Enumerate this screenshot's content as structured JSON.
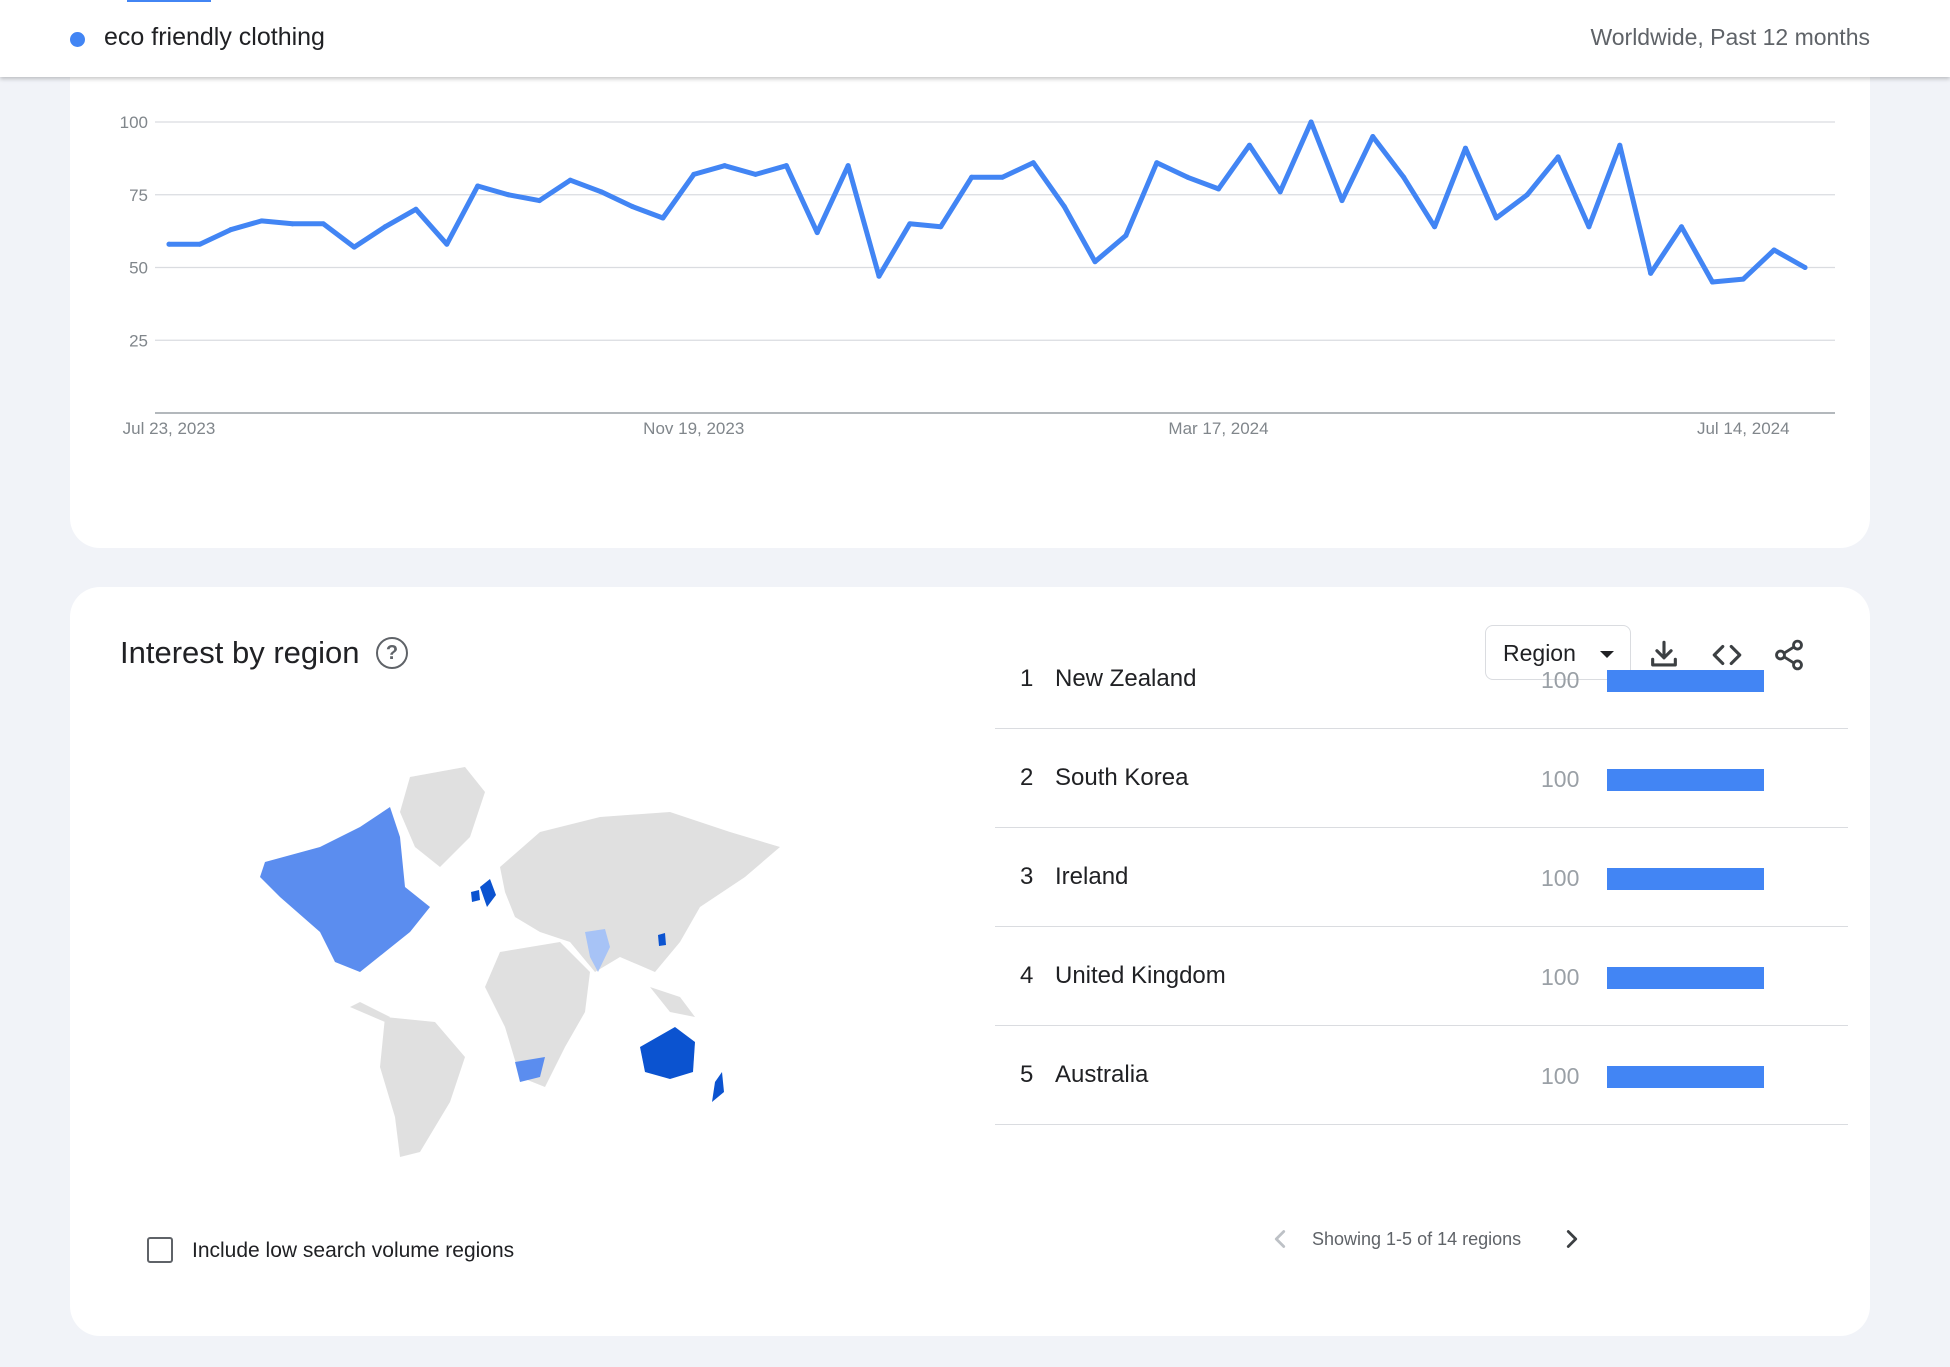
{
  "header": {
    "term": "eco friendly clothing",
    "term_color": "#4285f4",
    "scope": "Worldwide, Past 12 months"
  },
  "chart_data": {
    "type": "line",
    "title": "",
    "xlabel": "",
    "ylabel": "",
    "ylim": [
      0,
      100
    ],
    "yticks": [
      "100",
      "75",
      "50",
      "25"
    ],
    "xticks": [
      "Jul 23, 2023",
      "Nov 19, 2023",
      "Mar 17, 2024",
      "Jul 14, 2024"
    ],
    "grid": true,
    "series": [
      {
        "color": "#4285f4",
        "x": [
          "2023-07-23",
          "2023-07-30",
          "2023-08-06",
          "2023-08-13",
          "2023-08-20",
          "2023-08-27",
          "2023-09-03",
          "2023-09-10",
          "2023-09-17",
          "2023-09-24",
          "2023-10-01",
          "2023-10-08",
          "2023-10-15",
          "2023-10-22",
          "2023-10-29",
          "2023-11-05",
          "2023-11-12",
          "2023-11-19",
          "2023-11-26",
          "2023-12-03",
          "2023-12-10",
          "2023-12-17",
          "2023-12-24",
          "2023-12-31",
          "2024-01-07",
          "2024-01-14",
          "2024-01-21",
          "2024-01-28",
          "2024-02-04",
          "2024-02-11",
          "2024-02-18",
          "2024-02-25",
          "2024-03-03",
          "2024-03-10",
          "2024-03-17",
          "2024-03-24",
          "2024-03-31",
          "2024-04-07",
          "2024-04-14",
          "2024-04-21",
          "2024-04-28",
          "2024-05-05",
          "2024-05-12",
          "2024-05-19",
          "2024-05-26",
          "2024-06-02",
          "2024-06-09",
          "2024-06-16",
          "2024-06-23",
          "2024-06-30",
          "2024-07-07",
          "2024-07-14",
          "2024-07-21",
          "2024-07-28"
        ],
        "values": [
          58,
          58,
          63,
          66,
          65,
          65,
          57,
          64,
          70,
          58,
          78,
          75,
          73,
          80,
          76,
          71,
          67,
          82,
          85,
          82,
          85,
          62,
          85,
          47,
          65,
          64,
          81,
          81,
          86,
          71,
          52,
          61,
          86,
          81,
          77,
          92,
          76,
          100,
          73,
          95,
          81,
          64,
          91,
          67,
          75,
          88,
          64,
          92,
          48,
          64,
          45,
          46,
          56,
          50
        ]
      }
    ]
  },
  "region": {
    "title": "Interest by region",
    "help_icon": "help-circle-icon",
    "selector_label": "Region",
    "tools": [
      "download-icon",
      "embed-code-icon",
      "share-icon"
    ],
    "map_colors": {
      "land_no_data": "#e0e0e0",
      "land_medium": "#5b8def",
      "land_light": "#a7c3f6",
      "land_high": "#0b53d0"
    },
    "items": [
      {
        "rank": "1",
        "name": "New Zealand",
        "value": 100
      },
      {
        "rank": "2",
        "name": "South Korea",
        "value": 100
      },
      {
        "rank": "3",
        "name": "Ireland",
        "value": 100
      },
      {
        "rank": "4",
        "name": "United Kingdom",
        "value": 100
      },
      {
        "rank": "5",
        "name": "Australia",
        "value": 100
      }
    ],
    "pagination": "Showing 1-5 of 14 regions",
    "low_volume_label": "Include low search volume regions",
    "low_volume_checked": false
  }
}
